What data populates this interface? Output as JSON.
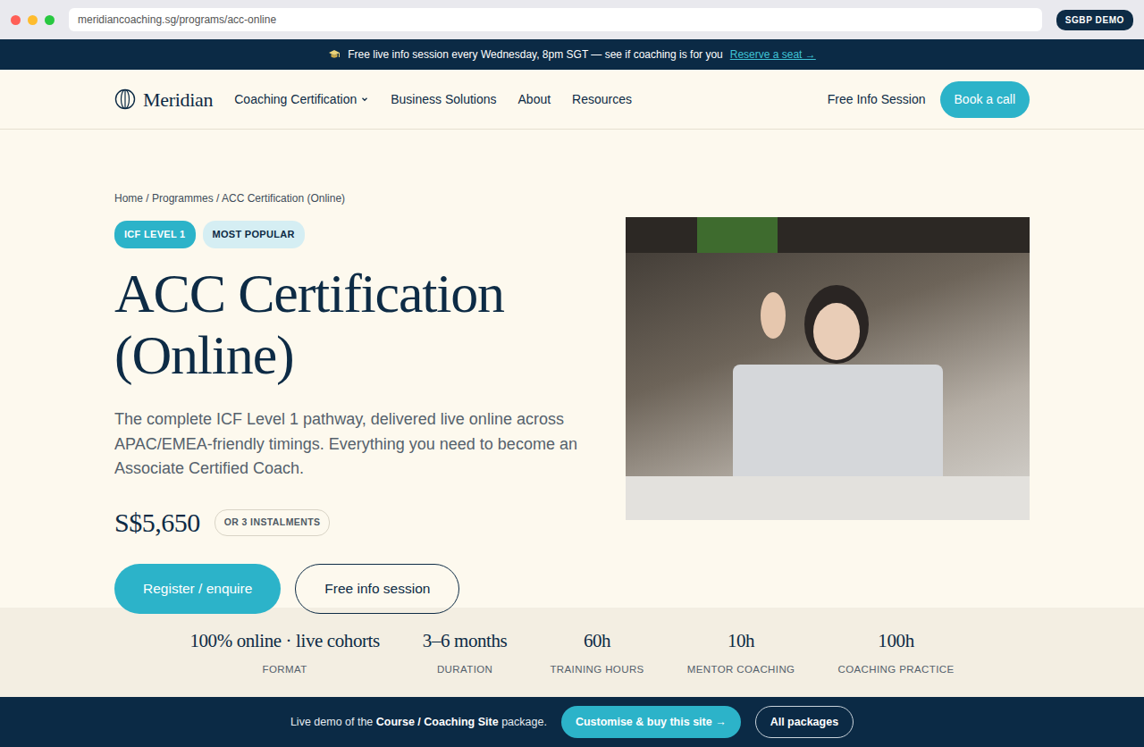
{
  "browser": {
    "url": "meridiancoaching.sg/programs/acc-online",
    "badge": "SGBP DEMO"
  },
  "announcement": {
    "text": "Free live info session every Wednesday, 8pm SGT — see if coaching is for you",
    "link": "Reserve a seat →"
  },
  "nav": {
    "logo": "Meridian",
    "items": [
      {
        "label": "Coaching Certification",
        "dropdown": true
      },
      {
        "label": "Business Solutions",
        "dropdown": false
      },
      {
        "label": "About",
        "dropdown": false
      },
      {
        "label": "Resources",
        "dropdown": false
      }
    ],
    "info_link": "Free Info Session",
    "cta": "Book a call"
  },
  "hero": {
    "breadcrumb": "Home / Programmes / ACC Certification (Online)",
    "badges": [
      {
        "label": "ICF LEVEL 1",
        "kind": "primary"
      },
      {
        "label": "MOST POPULAR",
        "kind": "secondary"
      }
    ],
    "title": "ACC Certification (Online)",
    "description": "The complete ICF Level 1 pathway, delivered live online across APAC/EMEA-friendly timings. Everything you need to become an Associate Certified Coach.",
    "price": "S$5,650",
    "price_note": "OR 3 INSTALMENTS",
    "buttons": [
      {
        "label": "Register / enquire",
        "kind": "primary"
      },
      {
        "label": "Free info session",
        "kind": "outline"
      }
    ]
  },
  "stats": [
    {
      "value": "100% online · live cohorts",
      "label": "FORMAT"
    },
    {
      "value": "3–6 months",
      "label": "DURATION"
    },
    {
      "value": "60h",
      "label": "TRAINING HOURS"
    },
    {
      "value": "10h",
      "label": "MENTOR COACHING"
    },
    {
      "value": "100h",
      "label": "COACHING PRACTICE"
    }
  ],
  "demo_bar": {
    "text_before": "Live demo of the",
    "package": "Course / Coaching Site",
    "text_after": "package.",
    "buttons": [
      {
        "label": "Customise & buy this site →",
        "kind": "primary"
      },
      {
        "label": "All packages",
        "kind": "outline"
      }
    ]
  }
}
